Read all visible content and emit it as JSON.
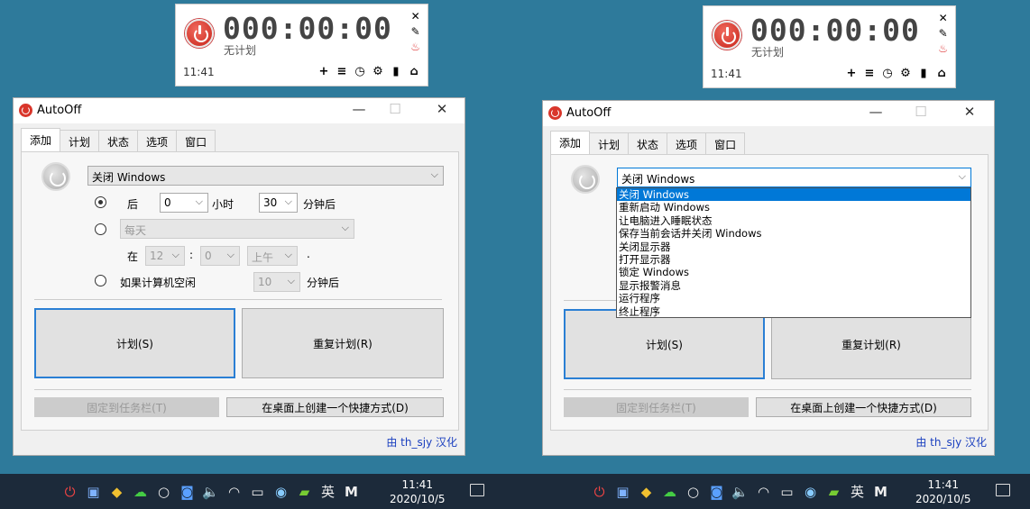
{
  "widget": {
    "time_display": "000:00:00",
    "status": "无计划",
    "clock": "11:41",
    "icons": [
      "plus-icon",
      "list-icon",
      "clock-icon",
      "gear-icon",
      "lock-icon",
      "home-icon"
    ],
    "icon_glyphs": [
      "+",
      "≡",
      "◷",
      "⚙",
      "▮",
      "⌂"
    ],
    "close_glyph": "✕",
    "pin_glyph": "✎",
    "drop_glyph": "♨"
  },
  "window": {
    "title": "AutoOff",
    "min_glyph": "—",
    "max_glyph": "☐",
    "close_glyph": "✕",
    "tabs": [
      "添加",
      "计划",
      "状态",
      "选项",
      "窗口"
    ],
    "action_select": "关闭 Windows",
    "after_label": "后",
    "hours_value": "0",
    "hours_unit": "小时",
    "minutes_value": "30",
    "minutes_unit": "分钟后",
    "daily_select": "每天",
    "at_label": "在",
    "at_hour": "12",
    "at_sep": ":",
    "at_min": "0",
    "at_ampm": "上午",
    "at_dot": ".",
    "idle_label": "如果计算机空闲",
    "idle_value": "10",
    "idle_unit": "分钟后",
    "schedule_button": "计划(S)",
    "repeat_button": "重复计划(R)",
    "pin_taskbar_button": "固定到任务栏(T)",
    "desktop_shortcut_button": "在桌面上创建一个快捷方式(D)",
    "credit": "由 th_sjy 汉化"
  },
  "dropdown_options": [
    "关闭 Windows",
    "重新启动 Windows",
    "让电脑进入睡眠状态",
    "保存当前会话并关闭 Windows",
    "关闭显示器",
    "打开显示器",
    "锁定 Windows",
    "显示报警消息",
    "运行程序",
    "终止程序"
  ],
  "taskbar": {
    "tray_icons": [
      "power-icon",
      "app-icon",
      "shield-icon",
      "wechat-icon",
      "circle-icon",
      "app2-icon",
      "volume-icon",
      "wifi-icon",
      "battery-icon",
      "network-icon",
      "nvidia-icon",
      "ime-icon",
      "m-icon"
    ],
    "tray_glyphs": [
      "⏻",
      "▣",
      "◆",
      "☁",
      "○",
      "◙",
      "🔈",
      "◠",
      "▭",
      "◉",
      "▰",
      "英",
      "M"
    ],
    "time": "11:41",
    "date": "2020/10/5"
  }
}
